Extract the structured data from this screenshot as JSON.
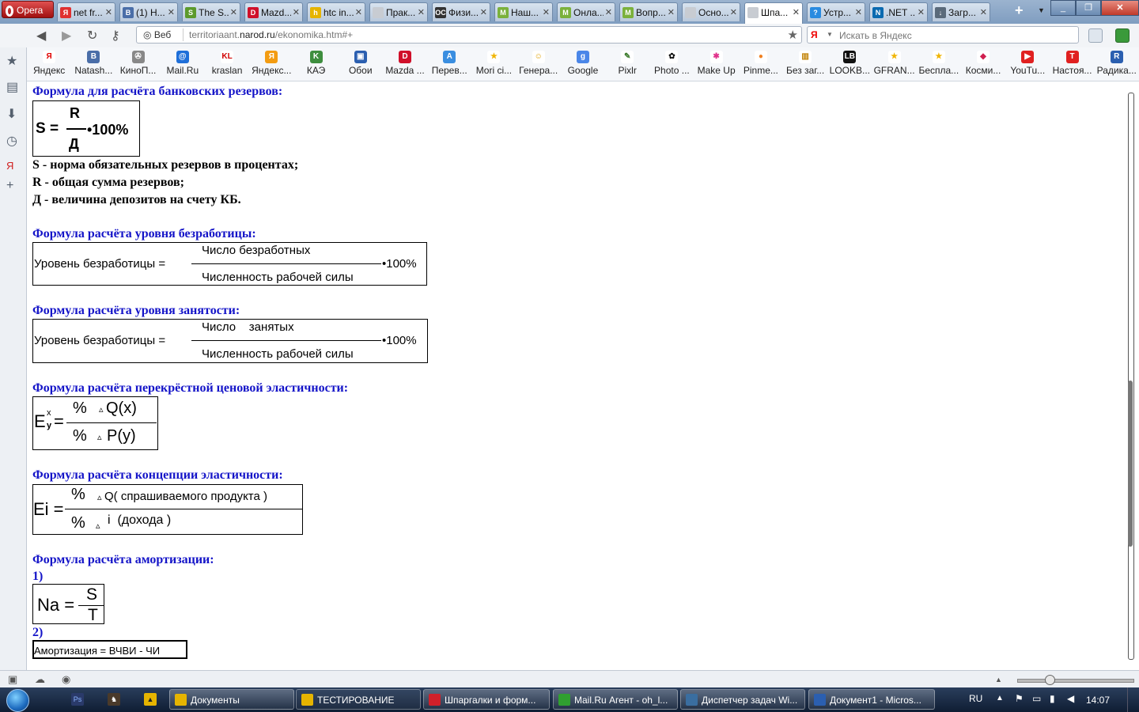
{
  "browser": {
    "menu_label": "Opera",
    "tabs": [
      {
        "title": "net fr...",
        "icon": "yandex-icon",
        "color": "#e03030",
        "glyph": "Я"
      },
      {
        "title": "(1) Н...",
        "icon": "vk-icon",
        "color": "#4a6ea8",
        "glyph": "B"
      },
      {
        "title": "The S...",
        "icon": "site-icon",
        "color": "#5c9a2c",
        "glyph": "S"
      },
      {
        "title": "Mazd...",
        "icon": "drive2-icon",
        "color": "#d0102a",
        "glyph": "D"
      },
      {
        "title": "htc in...",
        "icon": "folder-icon",
        "color": "#e6b400",
        "glyph": "h"
      },
      {
        "title": "Прак...",
        "icon": "page-icon",
        "color": "#c8ccd2",
        "glyph": ""
      },
      {
        "title": "Физи...",
        "icon": "pc-icon",
        "color": "#333333",
        "glyph": "ОС"
      },
      {
        "title": "Наш...",
        "icon": "map-icon",
        "color": "#7bb13c",
        "glyph": "М"
      },
      {
        "title": "Онла...",
        "icon": "map-icon",
        "color": "#7bb13c",
        "glyph": "М"
      },
      {
        "title": "Вопр...",
        "icon": "map-icon",
        "color": "#7bb13c",
        "glyph": "М"
      },
      {
        "title": "Осно...",
        "icon": "page-icon",
        "color": "#c8ccd2",
        "glyph": ""
      },
      {
        "title": "Шпа...",
        "icon": "page-icon",
        "color": "#c8ccd2",
        "glyph": "",
        "active": true
      },
      {
        "title": "Устр...",
        "icon": "ask-icon",
        "color": "#2a8be0",
        "glyph": "?"
      },
      {
        "title": ".NET ...",
        "icon": "net-icon",
        "color": "#0a6ab0",
        "glyph": "N"
      },
      {
        "title": "Загр...",
        "icon": "download-icon",
        "color": "#5a6a7a",
        "glyph": "↓"
      }
    ],
    "new_tab": "+",
    "tab_close": "✕",
    "nav": {
      "back": "◀",
      "forward": "▶",
      "reload": "↻",
      "key": "⚷"
    },
    "address": {
      "label": "Веб",
      "url_prefix": "territoriaant.",
      "url_domain": "narod.ru",
      "url_path": "/ekonomika.htm#+",
      "star": "★"
    },
    "search": {
      "placeholder": "Искать в Яндекс",
      "engine_glyph": "Я"
    },
    "bookmarks": [
      {
        "label": "Яндекс",
        "icon": "yandex-icon",
        "color": "#ffffff",
        "glyph": "Я",
        "fg": "#e00000"
      },
      {
        "label": "Natash...",
        "icon": "vk-icon",
        "color": "#4a6ea8",
        "glyph": "B",
        "fg": "#ffffff"
      },
      {
        "label": "КиноП...",
        "icon": "film-reel-icon",
        "color": "#888888",
        "glyph": "✇",
        "fg": "#ffffff"
      },
      {
        "label": "Mail.Ru",
        "icon": "mailru-icon",
        "color": "#1e6fd9",
        "glyph": "@",
        "fg": "#ffffff"
      },
      {
        "label": "kraslan",
        "icon": "kl-icon",
        "color": "#ffffff",
        "glyph": "KL",
        "fg": "#d00000"
      },
      {
        "label": "Яндекс...",
        "icon": "yandex-market-icon",
        "color": "#f39c12",
        "glyph": "Я",
        "fg": "#ffffff"
      },
      {
        "label": "КАЭ",
        "icon": "kae-icon",
        "color": "#3e8e3e",
        "glyph": "K",
        "fg": "#ffffff"
      },
      {
        "label": "Обои",
        "icon": "wallpaper-icon",
        "color": "#2b5fb0",
        "glyph": "▣",
        "fg": "#ffffff"
      },
      {
        "label": "Mazda ...",
        "icon": "drive2-icon",
        "color": "#d0102a",
        "glyph": "D",
        "fg": "#ffffff"
      },
      {
        "label": "Перев...",
        "icon": "translate-icon",
        "color": "#3a8ee0",
        "glyph": "A",
        "fg": "#ffffff"
      },
      {
        "label": "Mori ci...",
        "icon": "star-icon",
        "color": "#ffffff",
        "glyph": "★",
        "fg": "#f0b400"
      },
      {
        "label": "Генера...",
        "icon": "smiley-icon",
        "color": "#ffffff",
        "glyph": "☺",
        "fg": "#e0a000"
      },
      {
        "label": "Google",
        "icon": "google-icon",
        "color": "#4a86e8",
        "glyph": "g",
        "fg": "#ffffff"
      },
      {
        "label": "Pixlr",
        "icon": "brush-icon",
        "color": "#ffffff",
        "glyph": "✎",
        "fg": "#3a7a2a"
      },
      {
        "label": "Photo ...",
        "icon": "flower-icon",
        "color": "#ffffff",
        "glyph": "✿",
        "fg": "#111111"
      },
      {
        "label": "Make Up",
        "icon": "makeup-icon",
        "color": "#ffffff",
        "glyph": "✱",
        "fg": "#e0308a"
      },
      {
        "label": "Pinme...",
        "icon": "search-icon",
        "color": "#ffffff",
        "glyph": "●",
        "fg": "#f08020"
      },
      {
        "label": "Без заг...",
        "icon": "chart-icon",
        "color": "#ffffff",
        "glyph": "▥",
        "fg": "#c08000"
      },
      {
        "label": "LOOKB...",
        "icon": "lookbook-icon",
        "color": "#111111",
        "glyph": "LB",
        "fg": "#ffffff"
      },
      {
        "label": "GFRAN...",
        "icon": "star-icon",
        "color": "#ffffff",
        "glyph": "★",
        "fg": "#f0b400"
      },
      {
        "label": "Беспла...",
        "icon": "star-icon",
        "color": "#ffffff",
        "glyph": "★",
        "fg": "#f0b400"
      },
      {
        "label": "Косми...",
        "icon": "lips-icon",
        "color": "#ffffff",
        "glyph": "◆",
        "fg": "#d02050"
      },
      {
        "label": "YouTu...",
        "icon": "youtube-icon",
        "color": "#e02020",
        "glyph": "▶",
        "fg": "#ffffff"
      },
      {
        "label": "Настоя...",
        "icon": "t-icon",
        "color": "#e02020",
        "glyph": "T",
        "fg": "#ffffff"
      },
      {
        "label": "Радика...",
        "icon": "radikal-icon",
        "color": "#2b5fb0",
        "glyph": "R",
        "fg": "#ffffff"
      }
    ]
  },
  "page": {
    "s1": {
      "heading": "Формула для расчёта банковских резервов:",
      "lhs": "S =",
      "num": "R",
      "den": "Д",
      "mult": "•100%"
    },
    "defs": [
      "S - норма обязательных резервов в процентах;",
      "R - общая сумма резервов;",
      "Д - величина депозитов на счету КБ."
    ],
    "s2": {
      "heading": "Формула расчёта уровня безработицы:",
      "lhs": "Уровень безработицы =",
      "num": "Число безработных",
      "den": "Численность рабочей силы",
      "mult": "•100%"
    },
    "s3": {
      "heading": "Формула расчёта уровня занятости:",
      "lhs": "Уровень безработицы =",
      "num": "Число    занятых",
      "den": "Численность рабочей силы",
      "mult": "•100%"
    },
    "s4": {
      "heading": "Формула расчёта перекрёстной ценовой эластичности:",
      "lhs": "E",
      "sup": "x",
      "sub": "y",
      "eq": "=",
      "num_pct": "%",
      "num_delta": "▵",
      "num": "Q(x)",
      "den_pct": "%",
      "den_delta": "▵",
      "den": "P(y)"
    },
    "s5": {
      "heading": "Формула расчёта концепции эластичности:",
      "lhs": "Ei =",
      "num_pct": "%",
      "num_delta": "▵",
      "num": "Q( спрашиваемого продукта )",
      "den_pct": "%",
      "den_delta": "▵",
      "den": "i  (дохода )"
    },
    "s6": {
      "heading": "Формула расчёта амортизации:",
      "item1": "1)",
      "lhs": "Na =",
      "num": "S",
      "den": "T",
      "item2": "2)",
      "formula2": "Амортизация = ВЧВИ - ЧИ"
    }
  },
  "taskbar": {
    "buttons": [
      {
        "label": "Документы",
        "icon": "folder-icon",
        "color": "#e6b400"
      },
      {
        "label": "ТЕСТИРОВАНИЕ",
        "icon": "folder-icon",
        "color": "#e6b400"
      },
      {
        "label": "Шпаргалки и форм...",
        "icon": "opera-icon",
        "color": "#d0202a"
      },
      {
        "label": "Mail.Ru Агент - oh_l...",
        "icon": "mailru-agent-icon",
        "color": "#30a030"
      },
      {
        "label": "Диспетчер задач Wi...",
        "icon": "task-manager-icon",
        "color": "#3a6ea0"
      },
      {
        "label": "Документ1 - Micros...",
        "icon": "word-icon",
        "color": "#2b5fb0"
      }
    ],
    "lang": "RU",
    "time": "14:07"
  }
}
